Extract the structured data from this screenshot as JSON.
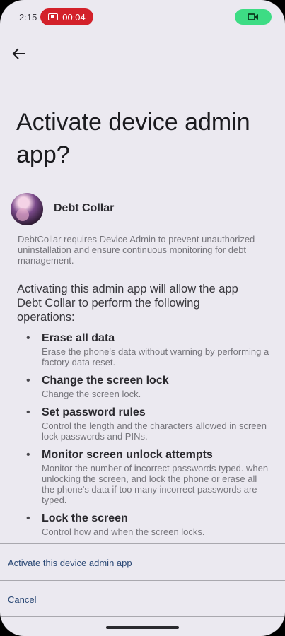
{
  "status_bar": {
    "time": "2:15",
    "recording_time": "00:04",
    "recording_color": "#d3212a",
    "camera_indicator_color": "#3ddc84"
  },
  "header": {
    "back_icon": "arrow-left-icon",
    "title": "Activate device admin app?"
  },
  "app": {
    "name": "Debt Collar",
    "description": "DebtCollar requires Device Admin to prevent unauthorized uninstallation and ensure continuous monitoring for debt management."
  },
  "warning": "Activating this admin app will allow the app Debt Collar to perform the following operations:",
  "operations": [
    {
      "title": "Erase all data",
      "description": "Erase the phone's data without warning by performing a factory data reset."
    },
    {
      "title": "Change the screen lock",
      "description": "Change the screen lock."
    },
    {
      "title": "Set password rules",
      "description": "Control the length and the characters allowed in screen lock passwords and PINs."
    },
    {
      "title": "Monitor screen unlock attempts",
      "description": "Monitor the number of incorrect passwords typed. when unlocking the screen, and lock the phone or erase all the phone's data if too many incorrect passwords are typed."
    },
    {
      "title": "Lock the screen",
      "description": "Control how and when the screen locks."
    }
  ],
  "actions": {
    "activate_label": "Activate this device admin app",
    "cancel_label": "Cancel"
  }
}
